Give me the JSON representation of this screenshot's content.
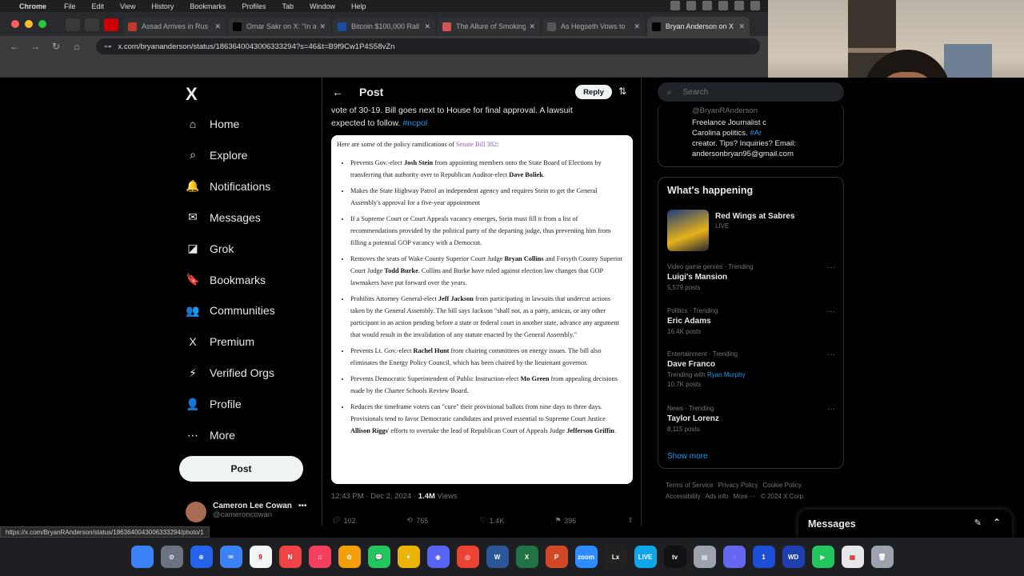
{
  "menubar": {
    "app": "Chrome",
    "items": [
      "File",
      "Edit",
      "View",
      "History",
      "Bookmarks",
      "Profiles",
      "Tab",
      "Window",
      "Help"
    ]
  },
  "tabs": [
    {
      "title": "Assad Arrives in Rus",
      "color": "#c0392b"
    },
    {
      "title": "Omar Sakr on X: \"In a",
      "color": "#000000"
    },
    {
      "title": "Bitcoin $100,000 Rall",
      "color": "#1a4fa0"
    },
    {
      "title": "The Allure of Smoking",
      "color": "#d35454"
    },
    {
      "title": "As Hegseth Vows to",
      "color": "#555555"
    },
    {
      "title": "Bryan Anderson on X",
      "color": "#000000"
    }
  ],
  "omnibox": {
    "url": "x.com/bryananderson/status/1863640043006333294?s=46&t=B9f9Cw1P4S58vZn"
  },
  "nav": {
    "logo": "X",
    "items": [
      {
        "label": "Home",
        "icon": "⌂",
        "name": "home"
      },
      {
        "label": "Explore",
        "icon": "⌕",
        "name": "explore"
      },
      {
        "label": "Notifications",
        "icon": "🔔",
        "name": "notifications"
      },
      {
        "label": "Messages",
        "icon": "✉",
        "name": "messages"
      },
      {
        "label": "Grok",
        "icon": "◪",
        "name": "grok"
      },
      {
        "label": "Bookmarks",
        "icon": "🔖",
        "name": "bookmarks"
      },
      {
        "label": "Communities",
        "icon": "👥",
        "name": "communities"
      },
      {
        "label": "Premium",
        "icon": "X",
        "name": "premium"
      },
      {
        "label": "Verified Orgs",
        "icon": "⚡",
        "name": "verified-orgs"
      },
      {
        "label": "Profile",
        "icon": "👤",
        "name": "profile"
      },
      {
        "label": "More",
        "icon": "⋯",
        "name": "more"
      }
    ],
    "post_button": "Post",
    "account_name": "Cameron Lee Cowan",
    "account_handle": "@cameroncowan"
  },
  "post": {
    "header": "Post",
    "reply": "Reply",
    "text_line1": "vote of 30-19. Bill goes next to House for final approval. A lawsuit",
    "text_line2": "expected to follow.",
    "hashtag": "#ncpol",
    "timestamp": "12:43 PM · Dec 2, 2024 ·",
    "views_count": "1.4M",
    "views_label": "Views",
    "replies": "102",
    "reposts": "765",
    "likes": "1.4K",
    "bookmarks": "396"
  },
  "document": {
    "intro": "Here are some of the policy ramifications of",
    "intro_link": "Senate Bill 382",
    "bullets": [
      [
        {
          "t": "Prevents Gov.-elect "
        },
        {
          "b": "Josh Stein"
        },
        {
          "t": " from appointing members onto the State Board of Elections by transferring that authority over to Republican Auditor-elect "
        },
        {
          "b": "Dave Boliek"
        },
        {
          "t": "."
        }
      ],
      [
        {
          "t": "Makes the State Highway Patrol an independent agency and requires Stein to get the General Assembly's approval for a five-year appointment"
        }
      ],
      [
        {
          "t": "If a Supreme Court or Court Appeals vacancy emerges, Stein must fill it from a list of recommendations provided by the political party of the departing judge, thus preventing him from filling a potential GOP vacancy with a Democrat."
        }
      ],
      [
        {
          "t": "Removes the seats of Wake County Superior Court Judge "
        },
        {
          "b": "Bryan Collins"
        },
        {
          "t": " and Forsyth County Superior Court Judge "
        },
        {
          "b": "Todd Burke"
        },
        {
          "t": ". Collins and Burke have ruled against election law changes that GOP lawmakers have put forward over the years."
        }
      ],
      [
        {
          "t": "Prohibits Attorney General-elect "
        },
        {
          "b": "Jeff Jackson"
        },
        {
          "t": " from participating in lawsuits that undercut actions taken by the General Assembly. The bill says Jackson \"shall not, as a party, amicus, or any other participant in an action pending before a state or federal court in another state, advance any argument that would result in the invalidation of any statute enacted by the General Assembly.\""
        }
      ],
      [
        {
          "t": "Prevents Lt. Gov.-elect "
        },
        {
          "b": "Rachel Hunt"
        },
        {
          "t": " from chairing committees on energy issues. The bill also eliminates the Energy Policy Council, which has been chaired by the lieutenant governor."
        }
      ],
      [
        {
          "t": "Prevents Democratic Superintendent of Public Instruction-elect "
        },
        {
          "b": "Mo Green"
        },
        {
          "t": " from appealing decisions made by the Charter Schools Review Board."
        }
      ],
      [
        {
          "t": "Reduces the timeframe voters can \"cure\" their provisional ballots from nine days to three days. Provisionals tend to favor Democratic candidates and proved essential to Supreme Court Justice "
        },
        {
          "b": "Allison Riggs"
        },
        {
          "t": "' efforts to overtake the lead of Republican Court of Appeals Judge "
        },
        {
          "b": "Jefferson Griffin"
        },
        {
          "t": "."
        }
      ]
    ]
  },
  "sidebar": {
    "search_placeholder": "Search",
    "profile_handle": "@BryanRAnderson",
    "profile_bio_1": "Freelance Journalist c",
    "profile_bio_2": "Carolina politics.",
    "profile_bio_tag": "#Ar",
    "profile_bio_3": "creator. Tips? Inquiries? Email:",
    "profile_bio_4": "andersonbryan95@gmail.com",
    "happening_title": "What's happening",
    "live_title": "Red Wings at Sabres",
    "live_label": "LIVE",
    "trends": [
      {
        "category": "Video game genres · Trending",
        "name": "Luigi's Mansion",
        "with": "",
        "with_link": "",
        "posts": "5,579 posts"
      },
      {
        "category": "Politics · Trending",
        "name": "Eric Adams",
        "with": "",
        "with_link": "",
        "posts": "16.4K posts"
      },
      {
        "category": "Entertainment · Trending",
        "name": "Dave Franco",
        "with": "Trending with",
        "with_link": "Ryan Murphy",
        "posts": "10.7K posts"
      },
      {
        "category": "News · Trending",
        "name": "Taylor Lorenz",
        "with": "",
        "with_link": "",
        "posts": "8,115 posts"
      }
    ],
    "show_more": "Show more",
    "footer": [
      "Terms of Service",
      "Privacy Policy",
      "Cookie Policy",
      "Accessibility",
      "Ads info",
      "More ···",
      "© 2024 X Corp."
    ]
  },
  "messages_dock": {
    "title": "Messages"
  },
  "status_url": "https://x.com/BryanRAnderson/status/1863640043006333294/photo/1",
  "dock": [
    {
      "name": "finder",
      "color": "#3b82f6",
      "glyph": ""
    },
    {
      "name": "system-settings",
      "color": "#6b7280",
      "glyph": "⚙"
    },
    {
      "name": "safari",
      "color": "#2563eb",
      "glyph": "⊕"
    },
    {
      "name": "mail",
      "color": "#3b82f6",
      "glyph": "✉"
    },
    {
      "name": "calendar",
      "color": "#f3f4f6",
      "glyph": "9"
    },
    {
      "name": "news",
      "color": "#ef4444",
      "glyph": "N"
    },
    {
      "name": "music",
      "color": "#f43f5e",
      "glyph": "♫"
    },
    {
      "name": "photos",
      "color": "#f59e0b",
      "glyph": "✿"
    },
    {
      "name": "messages",
      "color": "#22c55e",
      "glyph": "💬"
    },
    {
      "name": "butterfly",
      "color": "#eab308",
      "glyph": "✦"
    },
    {
      "name": "discord",
      "color": "#5865f2",
      "glyph": "◉"
    },
    {
      "name": "chrome",
      "color": "#ea4335",
      "glyph": "◎"
    },
    {
      "name": "word",
      "color": "#2b579a",
      "glyph": "W"
    },
    {
      "name": "excel",
      "color": "#217346",
      "glyph": "X"
    },
    {
      "name": "powerpoint",
      "color": "#d24726",
      "glyph": "P"
    },
    {
      "name": "zoom",
      "color": "#2d8cff",
      "glyph": "zoom"
    },
    {
      "name": "lx",
      "color": "#222222",
      "glyph": "Lx"
    },
    {
      "name": "live",
      "color": "#0ea5e9",
      "glyph": "LIVE"
    },
    {
      "name": "apple-tv",
      "color": "#111111",
      "glyph": "tv"
    },
    {
      "name": "files",
      "color": "#9ca3af",
      "glyph": "▤"
    },
    {
      "name": "chat",
      "color": "#6366f1",
      "glyph": "◌"
    },
    {
      "name": "1password",
      "color": "#1d4ed8",
      "glyph": "1"
    },
    {
      "name": "wd",
      "color": "#1e40af",
      "glyph": "WD"
    },
    {
      "name": "facetime",
      "color": "#22c55e",
      "glyph": "▶"
    },
    {
      "name": "document",
      "color": "#e5e7eb",
      "glyph": "▦"
    },
    {
      "name": "trash",
      "color": "#9ca3af",
      "glyph": "🗑"
    }
  ]
}
